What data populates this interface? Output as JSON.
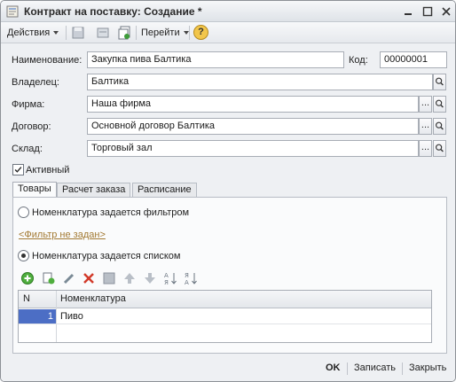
{
  "window": {
    "title": "Контракт на поставку: Создание *"
  },
  "toolbar": {
    "actions_label": "Действия",
    "goto_label": "Перейти",
    "help_label": "?"
  },
  "form": {
    "name_label": "Наименование:",
    "name_value": "Закупка пива Балтика",
    "code_label": "Код:",
    "code_value": "00000001",
    "owner_label": "Владелец:",
    "owner_value": "Балтика",
    "firm_label": "Фирма:",
    "firm_value": "Наша фирма",
    "contract_label": "Договор:",
    "contract_value": "Основной договор Балтика",
    "warehouse_label": "Склад:",
    "warehouse_value": "Торговый зал",
    "active_label": "Активный",
    "select_btn": "...",
    "active_checked": true
  },
  "tabs": [
    {
      "label": "Товары"
    },
    {
      "label": "Расчет заказа"
    },
    {
      "label": "Расписание"
    }
  ],
  "goods": {
    "radio_filter_label": "Номенклатура задается фильтром",
    "filter_link": "<Фильтр не задан>",
    "radio_list_label": "Номенклатура задается списком",
    "selected_mode": "list"
  },
  "table": {
    "col_n": "N",
    "col_name": "Номенклатура",
    "rows": [
      {
        "n": "1",
        "name": "Пиво"
      }
    ]
  },
  "footer": {
    "ok_label": "OK",
    "save_label": "Записать",
    "close_label": "Закрыть"
  },
  "colors": {
    "accent": "#4c6ec5",
    "link": "#a37a33"
  }
}
